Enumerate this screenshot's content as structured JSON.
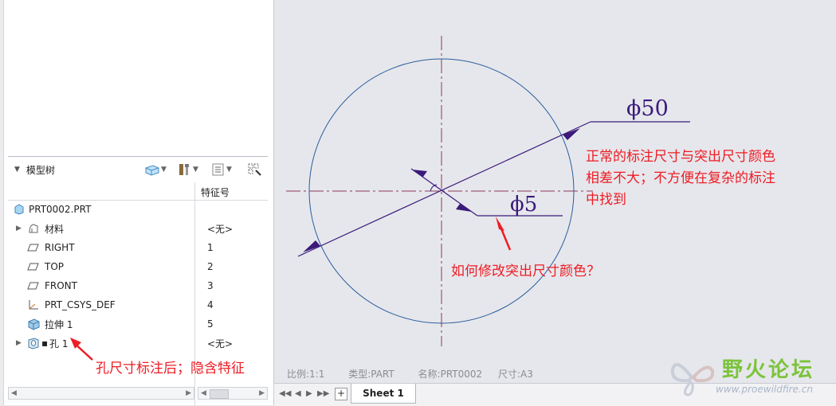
{
  "model_tree": {
    "title": "模型树",
    "column_header": "特征号",
    "root": "PRT0002.PRT",
    "items": [
      {
        "label": "材料",
        "num": "<无>",
        "icon": "material-icon",
        "expandable": true
      },
      {
        "label": "RIGHT",
        "num": "1",
        "icon": "datum-plane-icon",
        "expandable": false
      },
      {
        "label": "TOP",
        "num": "2",
        "icon": "datum-plane-icon",
        "expandable": false
      },
      {
        "label": "FRONT",
        "num": "3",
        "icon": "datum-plane-icon",
        "expandable": false
      },
      {
        "label": "PRT_CSYS_DEF",
        "num": "4",
        "icon": "csys-icon",
        "expandable": false
      },
      {
        "label": "拉伸 1",
        "num": "5",
        "icon": "extrude-icon",
        "expandable": false
      },
      {
        "label": "孔 1",
        "num": "<无>",
        "icon": "hole-icon",
        "expandable": true
      }
    ]
  },
  "drawing": {
    "dim_large": "ϕ50",
    "dim_small": "ϕ5",
    "status": {
      "scale": "比例:1:1",
      "type": "类型:PART",
      "name": "名称:PRT0002",
      "size": "尺寸:A3"
    },
    "sheet_tab": "Sheet 1",
    "colors": {
      "circle": "#2a5d9c",
      "dimension": "#3b1a7a",
      "centerline": "#8a3a5a",
      "annotation": "#ee1c24"
    }
  },
  "annotations": {
    "note_right": [
      "正常的标注尺寸与突出尺寸颜色",
      "相差不大；不方便在复杂的标注",
      "中找到"
    ],
    "note_question": "如何修改突出尺寸颜色？",
    "note_left": "孔尺寸标注后；隐含特征"
  },
  "watermark": {
    "title": "野火论坛",
    "url": "www.proewildfire.cn"
  }
}
